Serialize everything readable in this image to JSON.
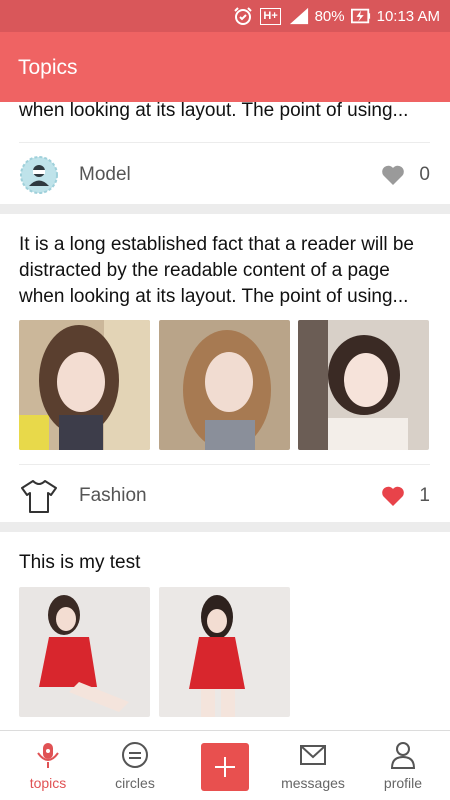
{
  "status_bar": {
    "battery": "80%",
    "time": "10:13 AM",
    "network": "H+"
  },
  "app_bar": {
    "title": "Topics"
  },
  "posts": [
    {
      "text_tail": "when looking at its layout. The point of using...",
      "category": "Model",
      "category_icon": "avatar-badge-icon",
      "likes": "0",
      "liked": false
    },
    {
      "text": "It is a long established fact that a reader will be distracted by the readable content of a page when looking at its layout. The point of using...",
      "images": [
        "photo-1",
        "photo-2",
        "photo-3"
      ],
      "category": "Fashion",
      "category_icon": "tshirt-icon",
      "likes": "1",
      "liked": true
    },
    {
      "text": "This is my test",
      "images": [
        "photo-4",
        "photo-5"
      ]
    }
  ],
  "nav": {
    "topics": "topics",
    "circles": "circles",
    "messages": "messages",
    "profile": "profile"
  },
  "colors": {
    "accent": "#ef6363",
    "status_bar": "#d9575a",
    "like_active": "#e8434a",
    "like_inactive": "#9a9a9a"
  }
}
